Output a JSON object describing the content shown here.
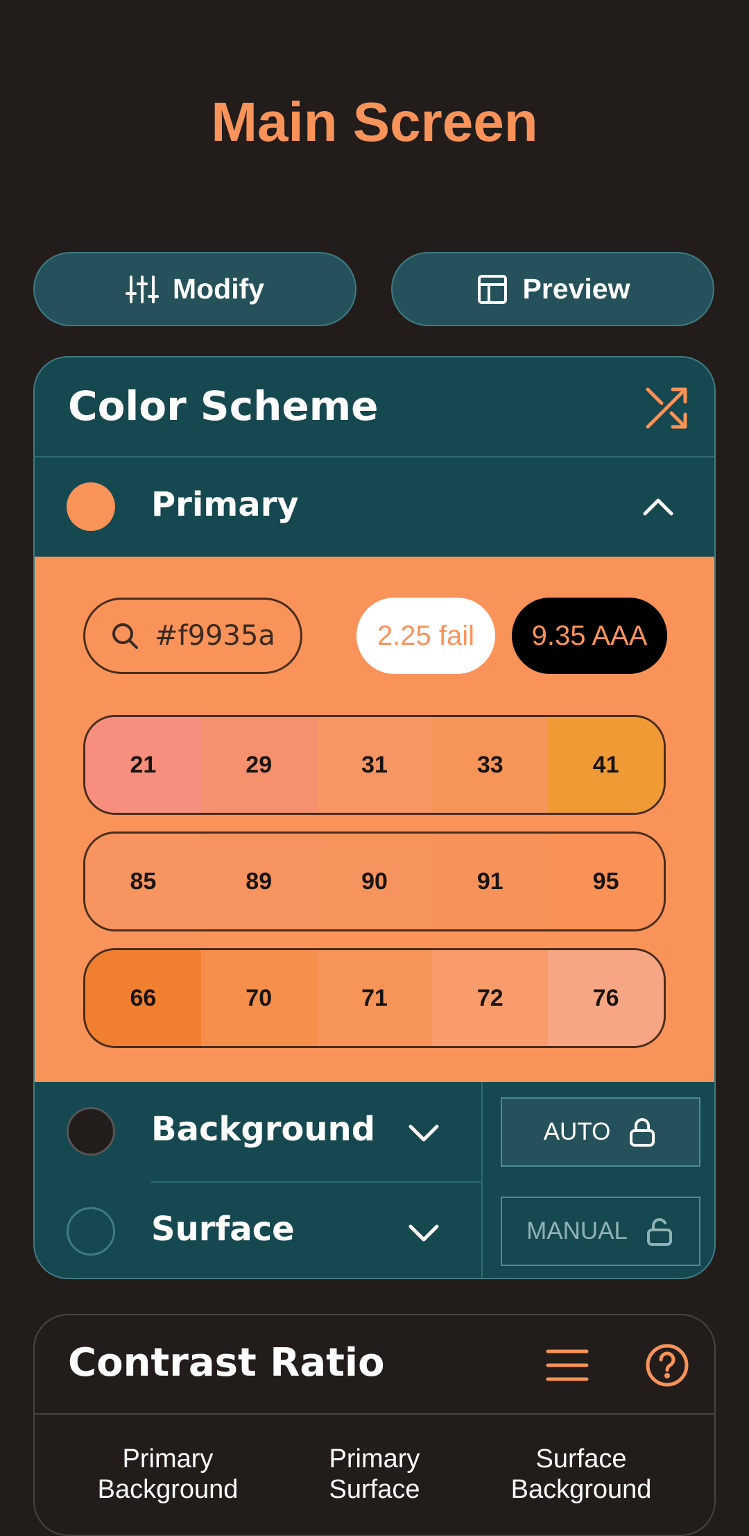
{
  "header": {
    "title": "Main Screen"
  },
  "actions": {
    "modify_label": "Modify",
    "preview_label": "Preview"
  },
  "color_scheme": {
    "title": "Color Scheme",
    "primary": {
      "label": "Primary",
      "color": "#f9935a",
      "hex_value": "#f9935a",
      "contrast_white": "2.25 fail",
      "contrast_black": "9.35 AAA",
      "tone_rows": [
        [
          {
            "label": "21",
            "color": "#f78e7e"
          },
          {
            "label": "29",
            "color": "#f7906c"
          },
          {
            "label": "31",
            "color": "#f79563"
          },
          {
            "label": "33",
            "color": "#f79558"
          },
          {
            "label": "41",
            "color": "#ef9a34"
          }
        ],
        [
          {
            "label": "85",
            "color": "#f79460"
          },
          {
            "label": "89",
            "color": "#f7935e"
          },
          {
            "label": "90",
            "color": "#f7935c"
          },
          {
            "label": "91",
            "color": "#f7935a"
          },
          {
            "label": "95",
            "color": "#fa9257"
          }
        ],
        [
          {
            "label": "66",
            "color": "#f08030"
          },
          {
            "label": "70",
            "color": "#f68e4c"
          },
          {
            "label": "71",
            "color": "#f79559"
          },
          {
            "label": "72",
            "color": "#f79c6a"
          },
          {
            "label": "76",
            "color": "#f7a684"
          }
        ]
      ]
    },
    "background": {
      "label": "Background",
      "color": "#221d1a",
      "lock_label": "AUTO"
    },
    "surface": {
      "label": "Surface",
      "color": "#164850",
      "lock_label": "MANUAL"
    }
  },
  "contrast": {
    "title": "Contrast Ratio",
    "columns": [
      {
        "line1": "Primary",
        "line2": "Background"
      },
      {
        "line1": "Primary",
        "line2": "Surface"
      },
      {
        "line1": "Surface",
        "line2": "Background"
      }
    ]
  }
}
